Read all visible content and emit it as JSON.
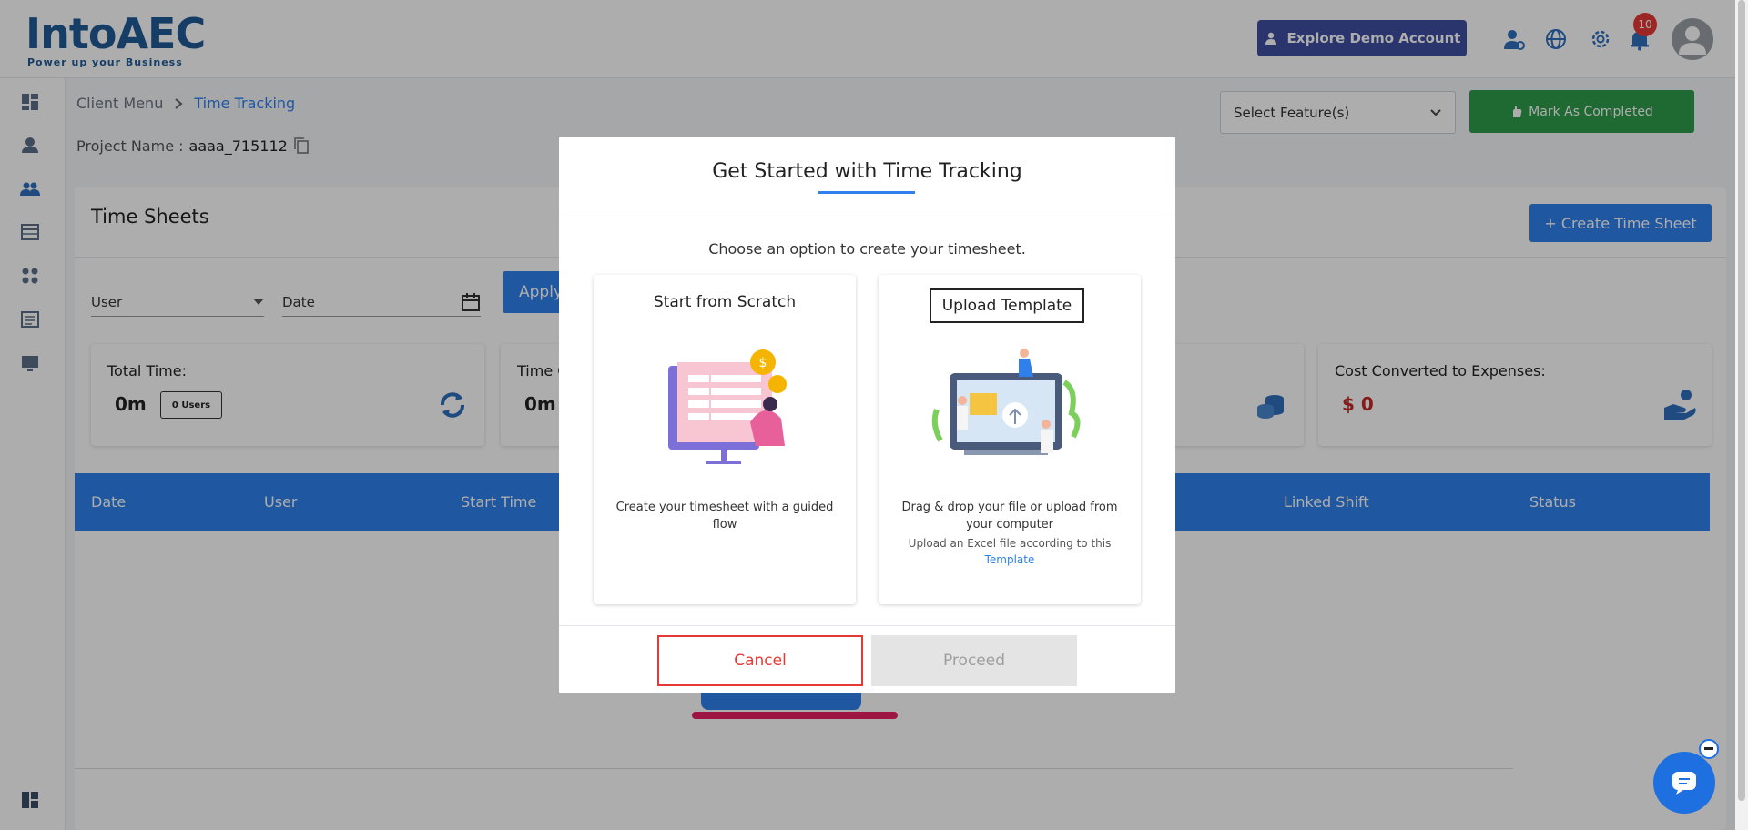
{
  "header": {
    "logo_text": "IntoAEC",
    "logo_tagline": "Power up your Business",
    "demo_button": "Explore Demo Account",
    "notification_count": "10"
  },
  "breadcrumb": {
    "parent": "Client Menu",
    "current": "Time Tracking"
  },
  "project": {
    "label": "Project Name :",
    "value": "aaaa_715112"
  },
  "toolbar": {
    "select_feature": "Select Feature(s)",
    "mark_completed": "Mark As Completed"
  },
  "timesheets": {
    "title": "Time Sheets",
    "create_button": "+ Create Time Sheet",
    "filters": {
      "user_label": "User",
      "date_label": "Date",
      "apply": "Apply"
    },
    "stats": [
      {
        "label": "Total Time:",
        "value": "0m",
        "chip": "0 Users"
      },
      {
        "label": "Time C",
        "value": "0m"
      },
      {
        "label": "Cost Converted to Expenses:",
        "value": "$ 0"
      }
    ],
    "columns": [
      "Date",
      "User",
      "Start Time",
      "Linked Shift",
      "Status"
    ]
  },
  "modal": {
    "title": "Get Started with Time Tracking",
    "subtitle": "Choose an option to create your timesheet.",
    "options": [
      {
        "title": "Start from Scratch",
        "description": "Create your timesheet with a guided flow"
      },
      {
        "title": "Upload Template",
        "description": "Drag & drop your file or upload from your computer",
        "note": "Upload an Excel file according to this",
        "link": "Template"
      }
    ],
    "cancel": "Cancel",
    "proceed": "Proceed"
  },
  "colors": {
    "primary": "#2f80ed",
    "success": "#2e9b4b",
    "danger": "#e53935",
    "demo": "#3d4fa0"
  }
}
